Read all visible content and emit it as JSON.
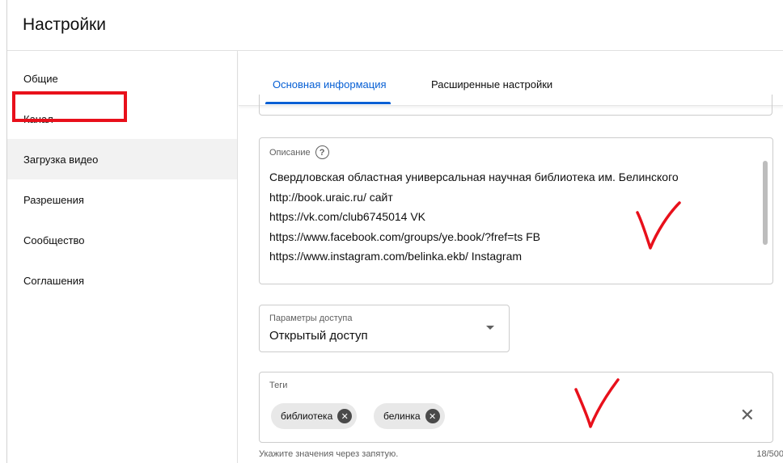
{
  "header": {
    "title": "Настройки"
  },
  "sidebar": {
    "items": [
      {
        "label": "Общие"
      },
      {
        "label": "Канал"
      },
      {
        "label": "Загрузка видео"
      },
      {
        "label": "Разрешения"
      },
      {
        "label": "Сообщество"
      },
      {
        "label": "Соглашения"
      }
    ]
  },
  "tabs": [
    {
      "label": "Основная информация"
    },
    {
      "label": "Расширенные настройки"
    }
  ],
  "description": {
    "label": "Описание",
    "help_icon": "?",
    "lines": [
      "Свердловская областная универсальная научная библиотека им. Белинского",
      "http://book.uraic.ru/ сайт",
      "https://vk.com/club6745014 VK",
      "https://www.facebook.com/groups/ye.book/?fref=ts FB",
      "https://www.instagram.com/belinka.ekb/ Instagram"
    ]
  },
  "access": {
    "label": "Параметры доступа",
    "value": "Открытый доступ"
  },
  "tags": {
    "label": "Теги",
    "chips": [
      "библиотека",
      "белинка"
    ],
    "chip_remove_symbol": "✕",
    "clear_symbol": "✕",
    "hint": "Укажите значения через запятую.",
    "counter": "18/500"
  },
  "colors": {
    "accent": "#065fd4",
    "highlight_box": "#e8101b",
    "annotation_check": "#e8101b"
  }
}
